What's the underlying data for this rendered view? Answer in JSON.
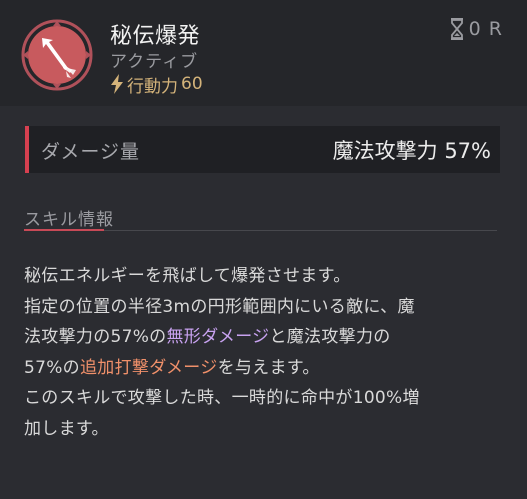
{
  "skill": {
    "name": "秘伝爆発",
    "type": "アクティブ",
    "action_label": "行動力",
    "action_value": "60",
    "cooldown": "0 R",
    "icon": "feathered-arrow-icon",
    "bolt_icon": "lightning-bolt-icon",
    "cooldown_icon": "hourglass-icon"
  },
  "damage": {
    "label": "ダメージ量",
    "value": "魔法攻撃力 57%"
  },
  "section": {
    "title": "スキル情報"
  },
  "description": {
    "line1": "秘伝エネルギーを飛ばして爆発させます。",
    "line2": "指定の位置の半径3mの円形範囲内にいる敵に、魔",
    "line3_a": "法攻撃力の57%の",
    "line3_hl": "無形ダメージ",
    "line3_b": "と魔法攻撃力の",
    "line4_a": "57%の",
    "line4_hl": "追加打撃ダメージ",
    "line4_b": "を与えます。",
    "line5": "このスキルで攻撃した時、一時的に命中が100%増",
    "line6": "加します。"
  },
  "colors": {
    "background": "#2b2c31",
    "header_background": "#25262a",
    "accent_red": "#d64050",
    "action_gold": "#d4b37a",
    "highlight_purple": "#c8a2f0",
    "highlight_orange": "#f0906a"
  }
}
